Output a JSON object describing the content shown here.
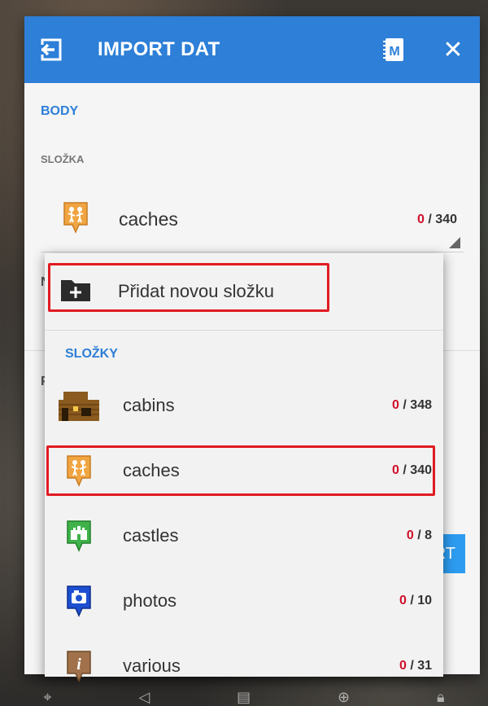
{
  "header": {
    "title": "IMPORT DAT",
    "import_icon": "import-icon",
    "manual_icon": "manual-icon",
    "close_icon": "close-icon",
    "manual_text": "M",
    "close_glyph": "✕"
  },
  "body_section_label": "BODY",
  "folder_section_label": "SLOŽKA",
  "selected_folder": {
    "name": "caches",
    "imported": "0",
    "total": "/ 340"
  },
  "hidden_left_letters": [
    "N",
    "P"
  ],
  "import_button_label": "RT",
  "dropdown": {
    "add_folder_label": "Přidat novou složku",
    "folders_header": "SLOŽKY",
    "items": [
      {
        "name": "cabins",
        "imported": "0",
        "total": "/ 348",
        "icon": "cabin-icon"
      },
      {
        "name": "caches",
        "imported": "0",
        "total": "/ 340",
        "icon": "geocache-icon"
      },
      {
        "name": "castles",
        "imported": "0",
        "total": "/ 8",
        "icon": "castle-icon"
      },
      {
        "name": "photos",
        "imported": "0",
        "total": "/ 10",
        "icon": "camera-icon"
      },
      {
        "name": "various",
        "imported": "0",
        "total": "/ 31",
        "icon": "info-icon"
      }
    ]
  },
  "colors": {
    "accent": "#2d7fd8",
    "highlight": "#e11b22",
    "zero_count": "#d0102a"
  }
}
